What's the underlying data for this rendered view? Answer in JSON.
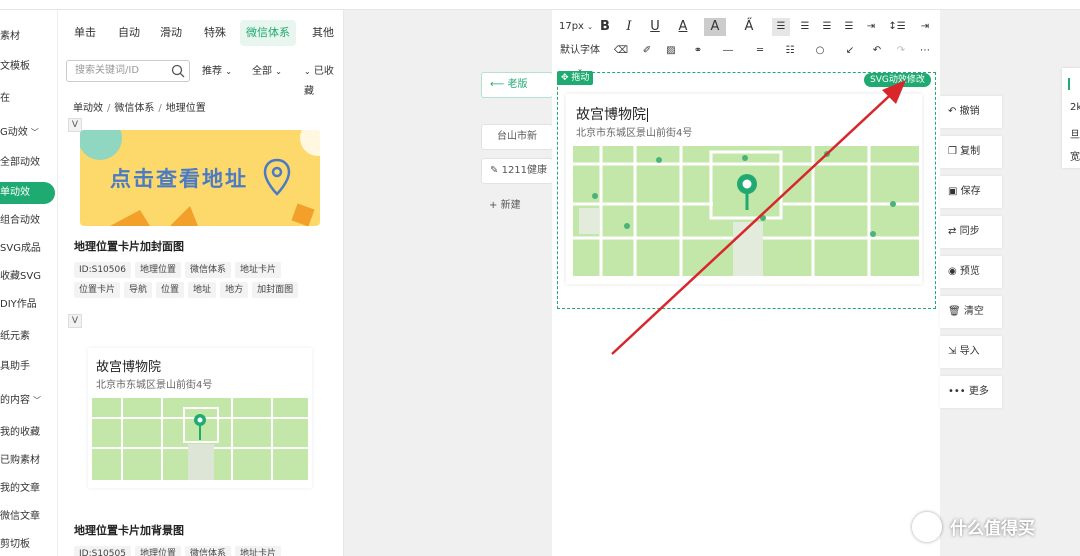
{
  "leftnav": {
    "items": [
      "素材",
      "文模板",
      "在",
      "G动效",
      "全部动效",
      "单动效",
      "组合动效",
      "SVG成品",
      "收藏SVG",
      "DIY作品",
      "纸元素",
      "具助手",
      "的内容",
      "我的收藏",
      "已购素材",
      "我的文章",
      "微信文章",
      "剪切板"
    ],
    "active_index": 5
  },
  "panel": {
    "tabs": [
      "单击",
      "自动",
      "滑动",
      "特殊",
      "微信体系",
      "其他"
    ],
    "active_tab": "微信体系",
    "search_placeholder": "搜索关键词/ID",
    "filters": [
      "推荐",
      "全部",
      "已收藏"
    ],
    "breadcrumb": [
      "单动效",
      "微信体系",
      "地理位置"
    ],
    "card1": {
      "cover_text": "点击查看地址",
      "title": "地理位置卡片加封面图",
      "tags_row1": [
        "ID:S10506",
        "地理位置",
        "微信体系",
        "地址卡片"
      ],
      "tags_row2": [
        "位置卡片",
        "导航",
        "位置",
        "地址",
        "地方",
        "加封面图"
      ]
    },
    "card2": {
      "place": "故宫博物院",
      "address": "北京市东城区景山前街4号",
      "title": "地理位置卡片加背景图",
      "tags_row1": [
        "ID:S10505",
        "地理位置",
        "微信体系",
        "地址卡片"
      ]
    }
  },
  "canvas": {
    "back_label": "老版",
    "article1": "台山市新",
    "article2": "1211健康",
    "new_label": "新建"
  },
  "toolbar": {
    "font_size": "17px",
    "font_family": "默认字体"
  },
  "editor": {
    "drag_label": "拖动",
    "svg_label": "SVG动效修改",
    "place": "故宫博物院",
    "address": "北京市东城区景山前街4号"
  },
  "actions": [
    "撤销",
    "复制",
    "保存",
    "同步",
    "预览",
    "清空",
    "导入",
    "更多"
  ],
  "rpanel": {
    "items": [
      "2k",
      "旦",
      "宽"
    ]
  },
  "watermark": "什么值得买",
  "colors": {
    "accent": "#1faa72",
    "arrow": "#d8262b",
    "map_green": "#bfe6a3"
  }
}
